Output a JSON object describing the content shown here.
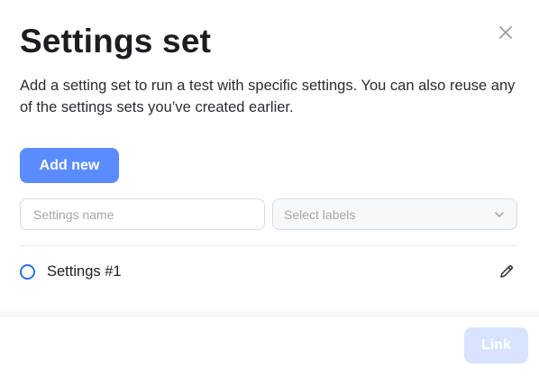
{
  "modal": {
    "title": "Settings set",
    "description": "Add a setting set to run a test with specific settings. You can also reuse any of the settings sets you’ve created earlier.",
    "close_icon": "close-icon"
  },
  "actions": {
    "add_new_label": "Add new",
    "link_label": "Link",
    "link_disabled": true
  },
  "filters": {
    "name_placeholder": "Settings name",
    "labels_placeholder": "Select labels",
    "labels_icon": "chevron-down-icon"
  },
  "settings_list": [
    {
      "label": "Settings #1",
      "selected": false,
      "edit_icon": "pencil-icon"
    }
  ],
  "colors": {
    "primary": "#5b8cff",
    "primary_disabled": "#d8e4ff",
    "radio_border": "#2f6fe0",
    "text": "#1d1d21"
  }
}
